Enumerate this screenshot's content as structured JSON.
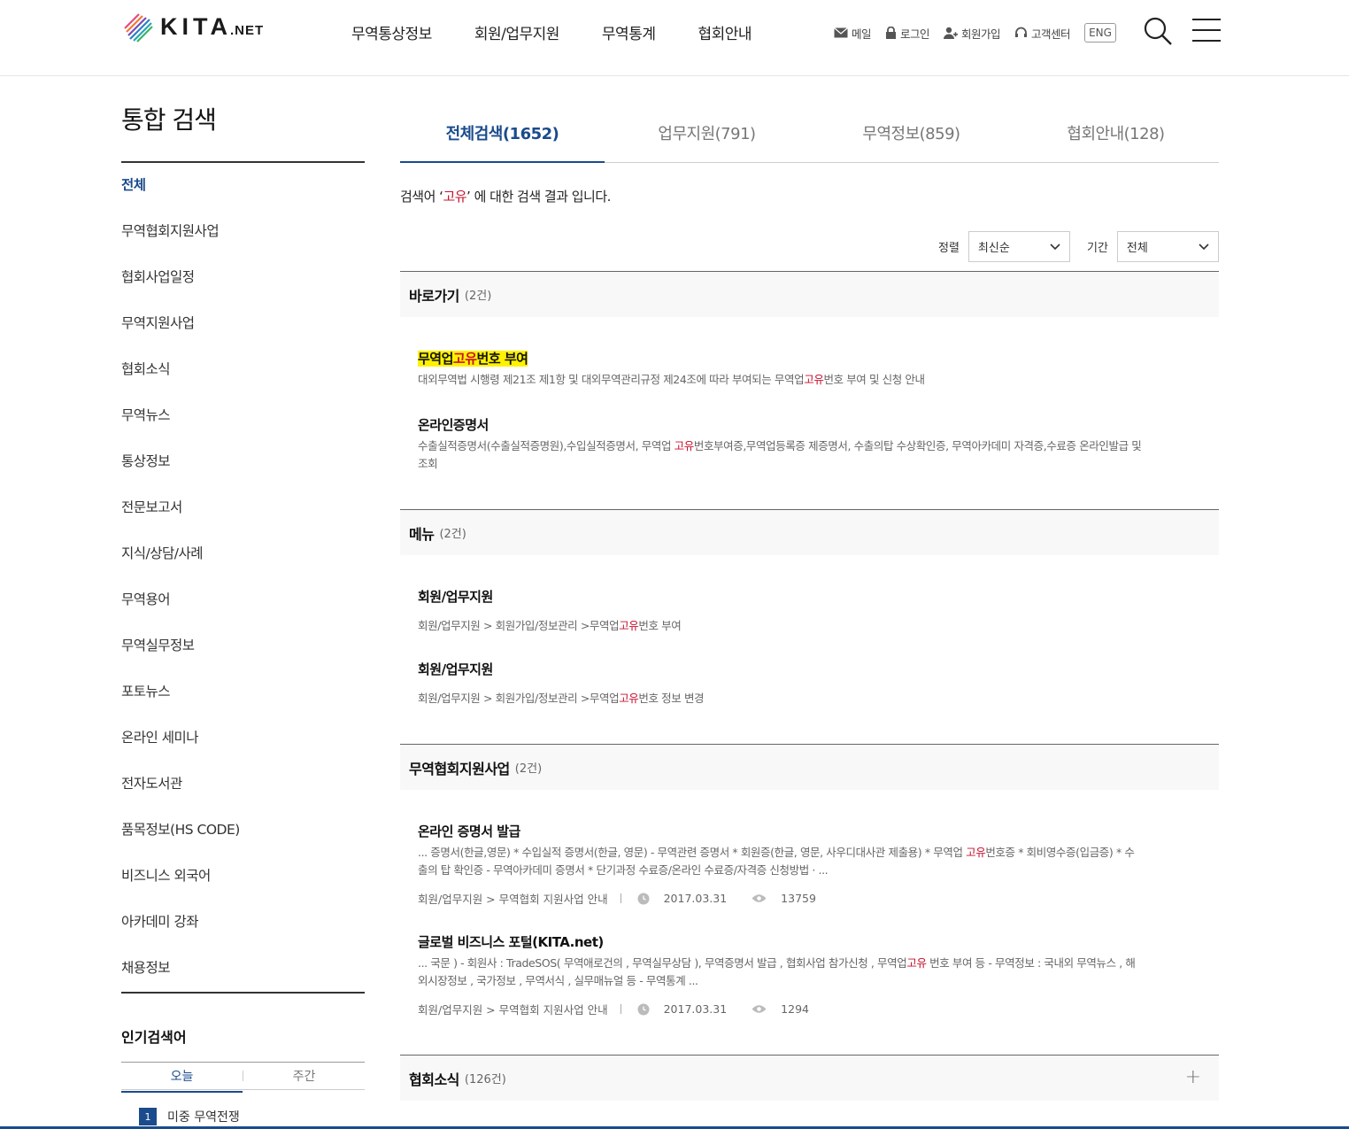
{
  "header": {
    "logo_text": "KITA",
    "logo_sub": ".NET",
    "gnb": [
      "무역통상정보",
      "회원/업무지원",
      "무역통계",
      "협회안내"
    ],
    "util": [
      {
        "label": "메일",
        "icon": "mail-icon"
      },
      {
        "label": "로그인",
        "icon": "lock-icon"
      },
      {
        "label": "회원가입",
        "icon": "user-add-icon"
      },
      {
        "label": "고객센터",
        "icon": "headset-icon"
      }
    ],
    "eng": "ENG"
  },
  "sidebar": {
    "title": "통합 검색",
    "items": [
      "전체",
      "무역협회지원사업",
      "협회사업일정",
      "무역지원사업",
      "협회소식",
      "무역뉴스",
      "통상정보",
      "전문보고서",
      "지식/상담/사례",
      "무역용어",
      "무역실무정보",
      "포토뉴스",
      "온라인 세미나",
      "전자도서관",
      "품목정보(HS CODE)",
      "비즈니스 외국어",
      "아카데미 강좌",
      "채용정보"
    ],
    "popular_title": "인기검색어",
    "popular_tabs": [
      "오늘",
      "주간"
    ],
    "popular_items": [
      {
        "rank": "1",
        "text": "미중 무역전쟁"
      }
    ]
  },
  "tabs": [
    "전체검색(1652)",
    "업무지원(791)",
    "무역정보(859)",
    "협회안내(128)"
  ],
  "result": {
    "prefix": "검색어 ‘",
    "keyword": "고유",
    "suffix": "’ 에 대한 검색 결과 입니다."
  },
  "filters": {
    "sort_label": "정렬",
    "sort_value": "최신순",
    "period_label": "기간",
    "period_value": "전체"
  },
  "sections": {
    "shortcut": {
      "title": "바로가기",
      "count": "(2건)"
    },
    "menu": {
      "title": "메뉴",
      "count": "(2건)"
    },
    "support": {
      "title": "무역협회지원사업",
      "count": "(2건)"
    },
    "news": {
      "title": "협회소식",
      "count": "(126건)",
      "expand": "+"
    }
  },
  "shortcut_items": [
    {
      "title_pre": "무역업",
      "title_kw": "고유",
      "title_post": "번호 부여",
      "desc_pre": "대외무역법 시행령 제21조 제1항 및 대외무역관리규정 제24조에 따라 부여되는 무역업",
      "desc_kw": "고유",
      "desc_post": "번호 부여 및 신청 안내"
    },
    {
      "title": "온라인증명서",
      "desc_pre": "수출실적증명서(수출실적증명원),수입실적증명서, 무역업 ",
      "desc_kw": "고유",
      "desc_post": "번호부여증,무역업등록증 제증명서, 수출의탑 수상확인증, 무역아카데미 자격증,수료증 온라인발급 및 조회"
    }
  ],
  "menu_items": [
    {
      "title": "회원/업무지원",
      "path_pre": "회원/업무지원 > 회원가입/정보관리 >무역업",
      "path_kw": "고유",
      "path_post": "번호 부여"
    },
    {
      "title": "회원/업무지원",
      "path_pre": "회원/업무지원 > 회원가입/정보관리 >무역업",
      "path_kw": "고유",
      "path_post": "번호 정보 변경"
    }
  ],
  "support_items": [
    {
      "title": "온라인 증명서 발급",
      "desc_pre": "... 증명서(한글,영문) * 수입실적 증명서(한글, 영문) - 무역관련 증명서 * 회원증(한글, 영문, 사우디대사관 제출용) * 무역업 ",
      "desc_kw": "고유",
      "desc_post": "번호증 * 회비영수증(입금증) * 수출의 탑 확인증 - 무역아카데미 증명서 * 단기과정 수료증/온라인 수료증/자격증 신청방법 · ...",
      "path": "회원/업무지원 > 무역협회 지원사업 안내",
      "date": "2017.03.31",
      "views": "13759"
    },
    {
      "title": "글로벌 비즈니스 포털(KITA.net)",
      "desc_pre": "... 국문 ) - 회원사 : TradeSOS( 무역애로건의 , 무역실무상담 ), 무역증명서 발급 , 협회사업 참가신청 , 무역업",
      "desc_kw": "고유",
      "desc_post": " 번호 부여 등 - 무역정보 : 국내외 무역뉴스 , 해외시장정보 , 국가정보 , 무역서식 , 실무매뉴얼 등 - 무역통계 ...",
      "path": "회원/업무지원 > 무역협회 지원사업 안내",
      "date": "2017.03.31",
      "views": "1294"
    }
  ],
  "colors": {
    "accent": "#1a4b8c",
    "keyword": "#c8102e",
    "highlight": "#fff200"
  }
}
